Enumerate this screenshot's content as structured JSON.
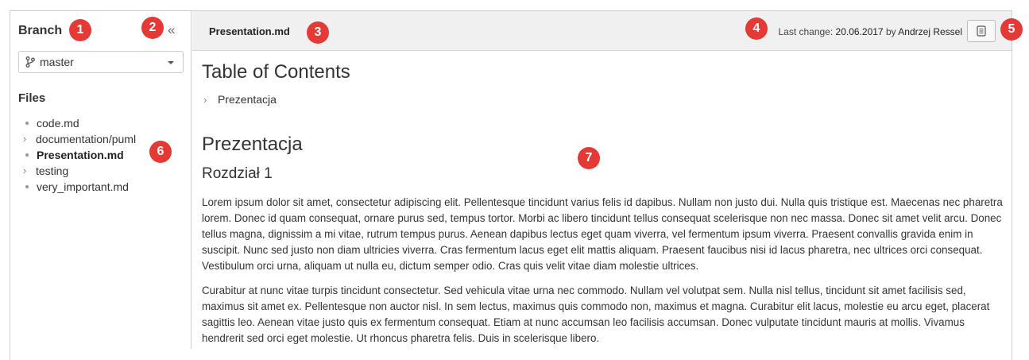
{
  "sidebar": {
    "branch_title": "Branch",
    "collapse_label": "«",
    "branch_value": "master",
    "files_title": "Files",
    "files": [
      {
        "label": "code.md",
        "kind": "file"
      },
      {
        "label": "documentation/puml",
        "kind": "folder"
      },
      {
        "label": "Presentation.md",
        "kind": "file",
        "active": true
      },
      {
        "label": "testing",
        "kind": "folder"
      },
      {
        "label": "very_important.md",
        "kind": "file"
      }
    ]
  },
  "header": {
    "file_title": "Presentation.md",
    "last_change_prefix": "Last change:",
    "last_change_date": "20.06.2017",
    "last_change_by": "by",
    "last_change_author": "Andrzej Ressel",
    "raw_button_icon": "document-icon"
  },
  "content": {
    "toc_heading": "Table of Contents",
    "toc_items": [
      "Prezentacja"
    ],
    "heading1": "Prezentacja",
    "heading2": "Rozdział 1",
    "paragraph1": "Lorem ipsum dolor sit amet, consectetur adipiscing elit. Pellentesque tincidunt varius felis id dapibus. Nullam non justo dui. Nulla quis tristique est. Maecenas nec pharetra lorem. Donec id quam consequat, ornare purus sed, tempus tortor. Morbi ac libero tincidunt tellus consequat scelerisque non nec massa. Donec sit amet velit arcu. Donec tellus magna, dignissim a mi vitae, rutrum tempus purus. Aenean dapibus lectus eget quam viverra, vel fermentum ipsum viverra. Praesent convallis gravida enim in suscipit. Nunc sed justo non diam ultricies viverra. Cras fermentum lacus eget elit mattis aliquam. Praesent faucibus nisi id lacus pharetra, nec ultrices orci consequat. Vestibulum orci urna, aliquam ut nulla eu, dictum semper odio. Cras quis velit vitae diam molestie ultrices.",
    "paragraph2": "Curabitur at nunc vitae turpis tincidunt consectetur. Sed vehicula vitae urna nec commodo. Nullam vel volutpat sem. Nulla nisl tellus, tincidunt sit amet facilisis sed, maximus sit amet ex. Pellentesque non auctor nisl. In sem lectus, maximus quis commodo non, maximus et magna. Curabitur elit lacus, molestie eu arcu eget, placerat sagittis leo. Aenean vitae justo quis ex fermentum consequat. Etiam at nunc accumsan leo facilisis accumsan. Donec vulputate tincidunt mauris at mollis. Vivamus hendrerit sed orci eget molestie. Ut rhoncus pharetra felis. Duis in scelerisque libero."
  },
  "markers": [
    "1",
    "2",
    "3",
    "4",
    "5",
    "6",
    "7"
  ],
  "colors": {
    "marker": "#e53935",
    "header_bg": "#f0f0f0"
  }
}
